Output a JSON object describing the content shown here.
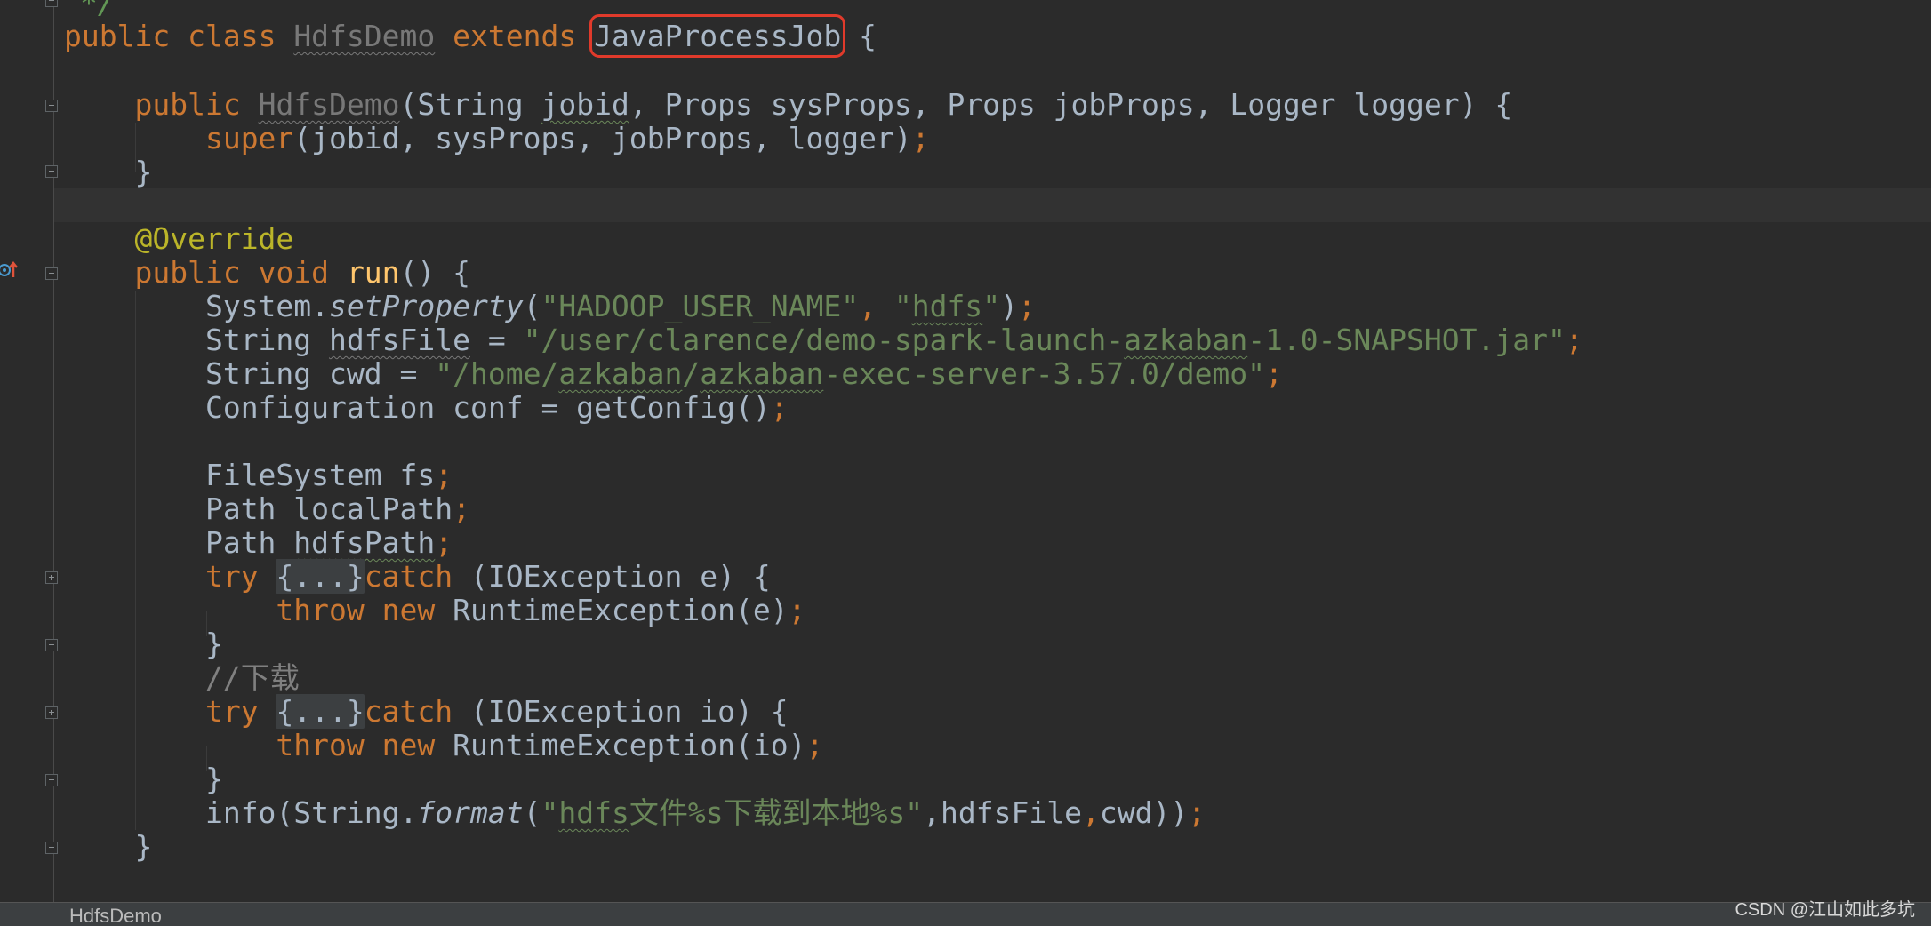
{
  "editor": {
    "file_tab": "HdfsDemo",
    "watermark": "CSDN @江山如此多坑",
    "colors": {
      "background": "#2b2b2b",
      "keyword": "#cc7832",
      "string": "#6a8759",
      "annotation": "#bbb529",
      "default_text": "#a9b7c6",
      "method_decl": "#ffc66d",
      "highlight_box": "#e03a2b"
    },
    "top_comment": "*/",
    "code": {
      "l1": {
        "public": "public",
        "class": "class",
        "classname": "HdfsDemo",
        "extends": "extends",
        "superclass": "JavaProcessJob",
        "brace": " {"
      },
      "l3": {
        "public": "public",
        "ctor": "HdfsDemo",
        "open": "(String ",
        "jobid": "jobid",
        "rest": ", Props sysProps, Props jobProps, Logger logger) {"
      },
      "l4": {
        "super": "super",
        "args": "(jobid, sysProps, jobProps, logger)",
        "semi": ";"
      },
      "l5": {
        "text": "}"
      },
      "l7": {
        "annotation": "@Override"
      },
      "l8": {
        "public": "public",
        "void": "void",
        "name": "run",
        "rest": "() {"
      },
      "l9": {
        "obj": "System.",
        "method": "setProperty",
        "open": "(",
        "s1": "\"HADOOP_USER_NAME\"",
        "comma": ", ",
        "s2a": "\"",
        "s2b": "hdfs",
        "s2c": "\"",
        "close": ")",
        "semi": ";"
      },
      "l10": {
        "pre": "String ",
        "var": "hdfsFile",
        "eq": " = ",
        "s_a": "\"/user/clarence/demo-spark-launch-",
        "s_b": "azkaban",
        "s_c": "-1.0-SNAPSHOT.jar\"",
        "semi": ";"
      },
      "l11": {
        "pre": "String cwd = ",
        "s_a": "\"/home/",
        "s_b": "azkaban",
        "s_c": "/",
        "s_d": "azkaban",
        "s_e": "-exec-server-3.57.0/demo\"",
        "semi": ";"
      },
      "l12": {
        "pre": "Configuration conf = getConfig()",
        "semi": ";"
      },
      "l14": {
        "pre": "FileSystem fs",
        "semi": ";"
      },
      "l15": {
        "pre": "Path localPath",
        "semi": ";"
      },
      "l16": {
        "pre": "Path ",
        "var": "hdfsPath",
        "semi": ";"
      },
      "l17": {
        "try": "try ",
        "folded": "{...}",
        "catch": "catch",
        "rest": " (IOException e) {"
      },
      "l18": {
        "throw": "throw",
        "new": "new",
        "rest": " RuntimeException(e)",
        "semi": ";"
      },
      "l19": {
        "text": "}"
      },
      "l20": {
        "comment": "//下载"
      },
      "l21": {
        "try": "try ",
        "folded": "{...}",
        "catch": "catch",
        "rest": " (IOException io) {"
      },
      "l22": {
        "throw": "throw",
        "new": "new",
        "rest": " RuntimeException(io)",
        "semi": ";"
      },
      "l23": {
        "text": "}"
      },
      "l24": {
        "pre": "info(String.",
        "method": "format",
        "open": "(",
        "s_a": "\"",
        "s_b": "hdfs",
        "s_c": "文件%s下载到本地%s\"",
        "args": ",hdfsFile",
        "comma": ",",
        "rest": "cwd))",
        "semi": ";"
      },
      "l25": {
        "text": "}"
      }
    }
  }
}
